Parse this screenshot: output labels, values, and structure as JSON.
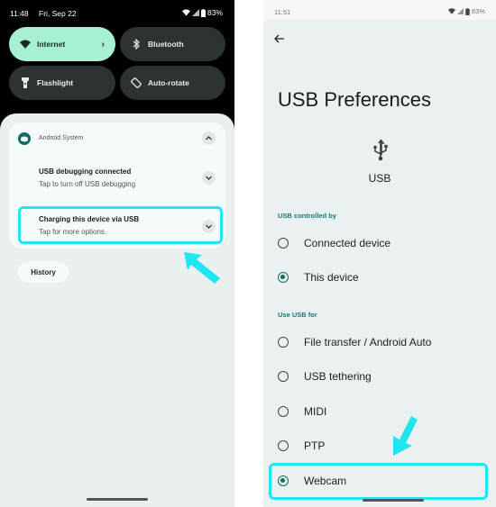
{
  "left_screen": {
    "status_bar": {
      "time": "11:48",
      "date": "Fri, Sep 22",
      "battery": "83%"
    },
    "quick_tiles": [
      {
        "label": "Internet",
        "icon": "wifi-icon",
        "active": true
      },
      {
        "label": "Bluetooth",
        "icon": "bluetooth-icon",
        "active": false
      },
      {
        "label": "Flashlight",
        "icon": "flashlight-icon",
        "active": false
      },
      {
        "label": "Auto-rotate",
        "icon": "auto-rotate-icon",
        "active": false
      }
    ],
    "notification_group": {
      "app_name": "Android System",
      "notifications": [
        {
          "title": "USB debugging connected",
          "subtitle": "Tap to turn off USB debugging"
        },
        {
          "title": "Charging this device via USB",
          "subtitle": "Tap for more options."
        }
      ]
    },
    "history_button": "History"
  },
  "right_screen": {
    "status_bar": {
      "time": "11:51",
      "battery": "83%"
    },
    "page_title": "USB Preferences",
    "usb_label": "USB",
    "sections": [
      {
        "header": "USB controlled by",
        "options": [
          {
            "label": "Connected device",
            "selected": false
          },
          {
            "label": "This device",
            "selected": true
          }
        ]
      },
      {
        "header": "Use USB for",
        "options": [
          {
            "label": "File transfer / Android Auto",
            "selected": false
          },
          {
            "label": "USB tethering",
            "selected": false
          },
          {
            "label": "MIDI",
            "selected": false
          },
          {
            "label": "PTP",
            "selected": false
          },
          {
            "label": "Webcam",
            "selected": true
          }
        ]
      }
    ]
  },
  "colors": {
    "highlight": "#1fe6f0",
    "accent": "#0f6b64",
    "active_tile": "#a7f1d3"
  }
}
